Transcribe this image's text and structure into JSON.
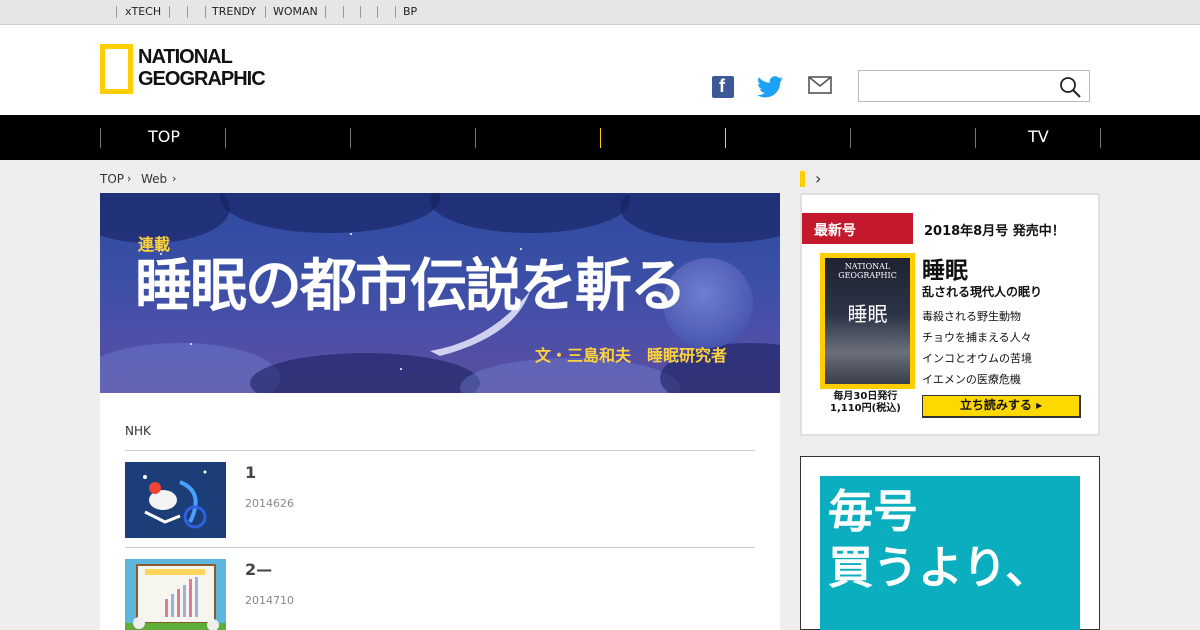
{
  "topbar": {
    "links": [
      "xTECH",
      "TRENDY",
      "WOMAN",
      "BP"
    ]
  },
  "header": {
    "logo_line1": "NATIONAL",
    "logo_line2": "GEOGRAPHIC",
    "search_placeholder": "",
    "social_icons": [
      "facebook-icon",
      "twitter-icon",
      "mail-icon"
    ]
  },
  "nav": {
    "items": [
      "TOP",
      "",
      "",
      "",
      "",
      "",
      "",
      "TV"
    ]
  },
  "breadcrumb": [
    "TOP",
    "Web"
  ],
  "hero": {
    "series_label": "連載",
    "title": "睡眠の都市伝説を斬る",
    "author": "文・三島和夫　睡眠研究者"
  },
  "article": {
    "source": "NHK",
    "items": [
      {
        "title": "1",
        "date": "2014626"
      },
      {
        "title": "2—",
        "date": "2014710"
      }
    ]
  },
  "sidebar": {
    "badge": "最新号",
    "issue": "2018年8月号 発売中！",
    "cover_brand": "NATIONAL GEOGRAPHIC",
    "cover_word": "睡眠",
    "cover_note_line1": "毎月30日発行",
    "cover_note_line2": "1,110円(税込)",
    "feature_title": "睡眠",
    "feature_sub": "乱される現代人の眠り",
    "topics": [
      "毒殺される野生動物",
      "チョウを捕まえる人々",
      "インコとオウムの苦境",
      "イエメンの医療危機"
    ],
    "read_button": "立ち読みする ▸",
    "ad_line1": "毎号",
    "ad_line2": "買うより、"
  },
  "colors": {
    "brand_yellow": "#ffce00",
    "badge_red": "#c4192d",
    "ad_teal": "#0aaebf",
    "nav_black": "#000000"
  }
}
